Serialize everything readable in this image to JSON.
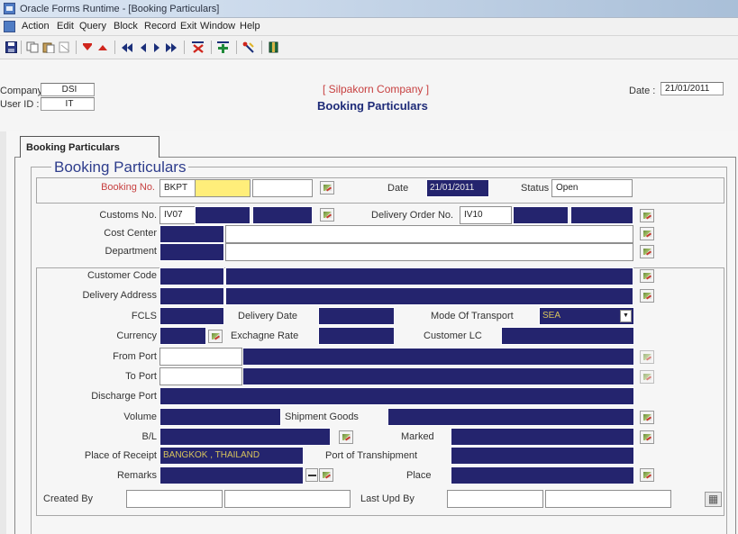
{
  "window": {
    "title": "Oracle Forms Runtime - [Booking Particulars]"
  },
  "menu": [
    "Action",
    "Edit",
    "Query",
    "Block",
    "Record",
    "Exit",
    "Window",
    "Help"
  ],
  "header": {
    "company_label": "Company :",
    "company_value": "DSI",
    "userid_label": "User ID :",
    "userid_value": "IT",
    "company_name": "[ Silpakorn Company ]",
    "form_title": "Booking Particulars",
    "date_label": "Date :",
    "date_value": "21/01/2011"
  },
  "tab": {
    "label": "Booking Particulars"
  },
  "group": {
    "title": "Booking Particulars"
  },
  "booking": {
    "booking_no_label": "Booking No.",
    "booking_no_prefix": "BKPT",
    "date_label": "Date",
    "date_value": "21/01/2011",
    "status_label": "Status",
    "status_value": "Open"
  },
  "fields": {
    "customs_no_label": "Customs No.",
    "customs_no_prefix": "IV07",
    "delivery_order_no_label": "Delivery Order No.",
    "delivery_order_no_prefix": "IV10",
    "cost_center_label": "Cost Center",
    "department_label": "Department",
    "customer_code_label": "Customer Code",
    "delivery_address_label": "Delivery Address",
    "fcls_label": "FCLS",
    "delivery_date_label": "Delivery Date",
    "mode_of_transport_label": "Mode Of Transport",
    "mode_of_transport_value": "SEA",
    "currency_label": "Currency",
    "exchange_rate_label": "Exchagne Rate",
    "customer_lc_label": "Customer LC",
    "from_port_label": "From Port",
    "to_port_label": "To Port",
    "discharge_port_label": "Discharge Port",
    "volume_label": "Volume",
    "shipment_goods_label": "Shipment Goods",
    "bl_label": "B/L",
    "marked_label": "Marked",
    "place_of_receipt_label": "Place of Receipt",
    "place_of_receipt_value": "BANGKOK , THAILAND",
    "port_of_transhipment_label": "Port of Transhipment",
    "remarks_label": "Remarks",
    "place_label": "Place",
    "created_by_label": "Created By",
    "last_upd_by_label": "Last Upd By"
  },
  "icons": {
    "toolbar": [
      "save-icon",
      "copy-icon",
      "paste-icon",
      "clear-icon",
      "insert-record-icon",
      "delete-record-icon",
      "first-record-icon",
      "previous-record-icon",
      "next-record-icon",
      "last-record-icon",
      "remove-record-icon",
      "add-record-icon",
      "query-icon",
      "exit-icon"
    ],
    "lov": "list-of-values-icon",
    "calculator": "calculator-icon"
  },
  "colors": {
    "field_dark": "#24246e",
    "field_current": "#ffee7a",
    "label_red": "#c74040",
    "title_blue": "#2e3d8c"
  }
}
